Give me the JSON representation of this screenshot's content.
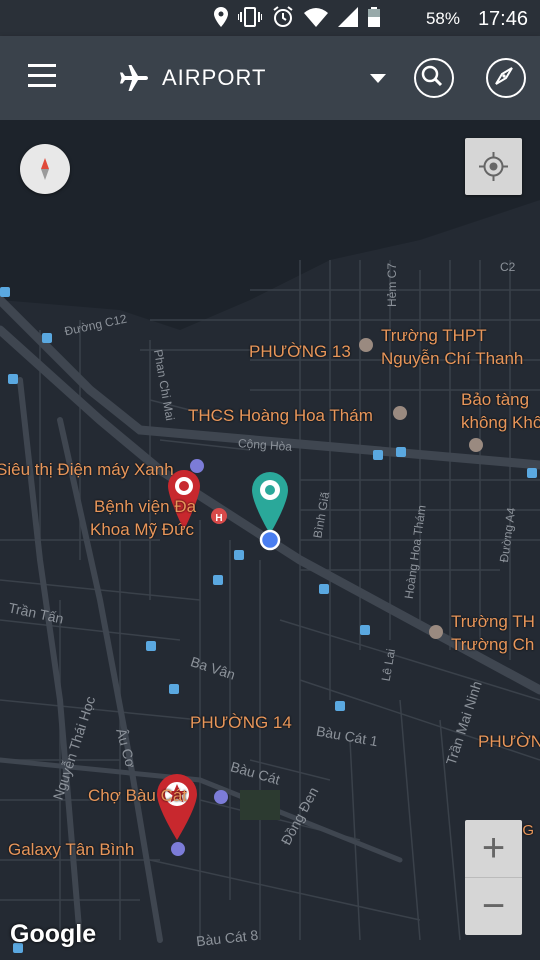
{
  "status_bar": {
    "battery": "58%",
    "time": "17:46"
  },
  "app_bar": {
    "title": "AIRPORT"
  },
  "map": {
    "attribution": "Google",
    "zoom_in": "+",
    "zoom_out": "−",
    "places": [
      "PHƯỜNG 13",
      "Trường THPT",
      "Nguyễn Chí Thanh",
      "Bảo tàng",
      "không Khô",
      "THCS Hoàng Hoa Thám",
      "Siêu thị Điện máy Xanh",
      "Bệnh viện Đa",
      "Khoa Mỹ Đức",
      "Trường TH",
      "Trường Ch",
      "PHƯỜNG 14",
      "PHƯỜN",
      "Chợ Bàu Cát",
      "Galaxy Tân Bình",
      "PHƯỜNG"
    ],
    "roads": [
      "Đường C12",
      "Cộng Hòa",
      "Phan Chi Mai",
      "Bình Giã",
      "Hoàng Hoa Thám",
      "Đường A4",
      "Hẻm C7",
      "C2",
      "Trần Tấn",
      "Ba Vân",
      "Lê Lai",
      "Trần Mai Ninh",
      "Bàu Cát 1",
      "Bàu Cát",
      "Đồng Đen",
      "Âu Cơ",
      "Nguyễn Thái Học",
      "Bàu Cát 8"
    ]
  }
}
